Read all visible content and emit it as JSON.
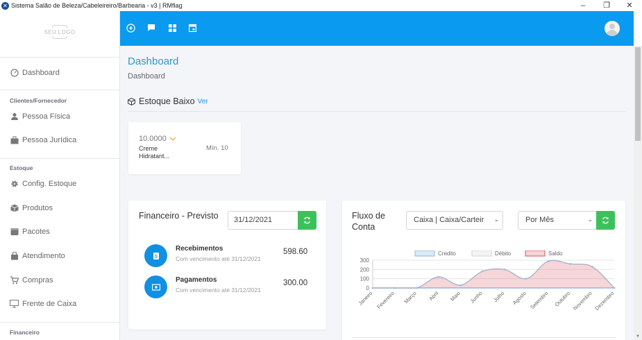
{
  "window": {
    "title": "Sistema Salão de Beleza/Cabeleireiro/Barbearia - v3 | RMflag",
    "minimize": "–",
    "maximize": "❐",
    "close": "✕"
  },
  "sidebar": {
    "logo": "SEU LOGO",
    "items": [
      {
        "label": "Dashboard",
        "icon": "dashboard-gauge-icon"
      },
      {
        "section": "Clientes/Fornecedor"
      },
      {
        "label": "Pessoa Física",
        "icon": "person-icon"
      },
      {
        "label": "Pessoa Jurídica",
        "icon": "briefcase-icon"
      },
      {
        "section": "Estoque"
      },
      {
        "label": "Config. Estoque",
        "icon": "gear-icon"
      },
      {
        "label": "Produtos",
        "icon": "box-icon"
      },
      {
        "label": "Pacotes",
        "icon": "package-icon"
      },
      {
        "label": "Atendimento",
        "icon": "bag-icon"
      },
      {
        "label": "Compras",
        "icon": "cart-icon"
      },
      {
        "label": "Frente de Caixa",
        "icon": "monitor-icon"
      },
      {
        "section": "Financeiro"
      }
    ]
  },
  "topbar": {
    "icons": [
      "back-circle-icon",
      "chat-icon",
      "grid-icon",
      "calendar-icon"
    ],
    "color": "#0a9af0"
  },
  "page": {
    "title": "Dashboard",
    "breadcrumb": "Dashboard"
  },
  "stock": {
    "title": "Estoque Baixo",
    "link": "Ver",
    "items": [
      {
        "qty": "10.0000",
        "name": "Creme Hidratant...",
        "min": "Mín. 10"
      }
    ]
  },
  "financeiro": {
    "title": "Financeiro - Previsto",
    "date": "31/12/2021",
    "rows": [
      {
        "label": "Recebimentos",
        "sub": "Com vencimento até 31/12/2021",
        "value": "598.60",
        "icon": "dollar-icon"
      },
      {
        "label": "Pagamentos",
        "sub": "Com vencimento até 31/12/2021",
        "value": "300.00",
        "icon": "money-bill-icon"
      }
    ]
  },
  "fluxo": {
    "title": "Fluxo de Conta",
    "account_select": "Caixa | Caixa/Carteir",
    "period_select": "Por Mês"
  },
  "chart_data": {
    "type": "area",
    "categories": [
      "Janeiro",
      "Fevereiro",
      "Março",
      "Abril",
      "Maio",
      "Junho",
      "Julho",
      "Agosto",
      "Setembro",
      "Outubro",
      "Novembro",
      "Dezembro"
    ],
    "series": [
      {
        "name": "Credito",
        "values": [
          0,
          0,
          0,
          0,
          0,
          0,
          0,
          0,
          0,
          0,
          0,
          0
        ],
        "color": "#9cc3e6"
      },
      {
        "name": "Débito",
        "values": [
          0,
          0,
          0,
          0,
          0,
          0,
          0,
          0,
          0,
          0,
          0,
          0
        ],
        "color": "#d9d9d9"
      },
      {
        "name": "Saldo",
        "values": [
          0,
          0,
          0,
          120,
          30,
          180,
          200,
          100,
          290,
          260,
          230,
          0
        ],
        "color": "#e06c75"
      }
    ],
    "yticks": [
      0,
      100,
      200,
      300
    ],
    "ylim": [
      0,
      300
    ],
    "legend_position": "top"
  }
}
